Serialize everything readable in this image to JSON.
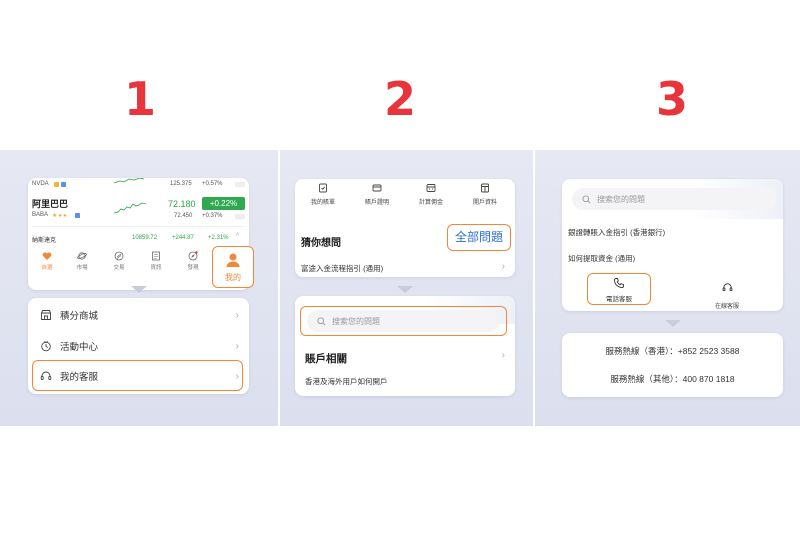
{
  "steps": [
    "1",
    "2",
    "3"
  ],
  "panel1": {
    "rows": {
      "nvda": {
        "ticker": "NVDA",
        "price": "125.375",
        "change": "+0.57%",
        "badge": "美"
      },
      "alibaba": {
        "name": "阿里巴巴",
        "ticker": "BABA",
        "price": "72.180",
        "change_pct": "+0.22%",
        "sub_price": "72.450",
        "sub_change": "+0.37%",
        "badge": "美"
      },
      "nasdaq": {
        "name": "納斯達克",
        "value": "10859.72",
        "change": "+244.87",
        "pct": "+2.31%"
      }
    },
    "nav": [
      "自選",
      "市場",
      "交易",
      "資訊",
      "發現",
      "我的"
    ],
    "menu": [
      {
        "label": "積分商城",
        "icon": "store-icon"
      },
      {
        "label": "活動中心",
        "icon": "activity-icon"
      },
      {
        "label": "我的客服",
        "icon": "headset-icon"
      }
    ],
    "accent": "#f0883a",
    "up_color": "#28a745"
  },
  "panel2": {
    "tools": [
      "我的賬單",
      "賬戶證明",
      "計算佣金",
      "開戶資料"
    ],
    "guess_title": "猜你想問",
    "all_questions": "全部問題",
    "faq1": "富途入金流程指引 (通用)",
    "search_placeholder": "搜索您的問題",
    "section_title": "賬戶相關",
    "faq2": "香港及海外用戶如何開戶"
  },
  "panel3": {
    "search_placeholder": "搜索您的問題",
    "q1": "銀證轉賬入金指引 (香港銀行)",
    "q2": "如何提取資金 (通用)",
    "phone_label": "電話客服",
    "online_label": "在線客服",
    "hotline_hk": "服務熱線（香港）：+852 2523 3588",
    "hotline_other": "服務熱線（其他）：400 870 1818"
  }
}
